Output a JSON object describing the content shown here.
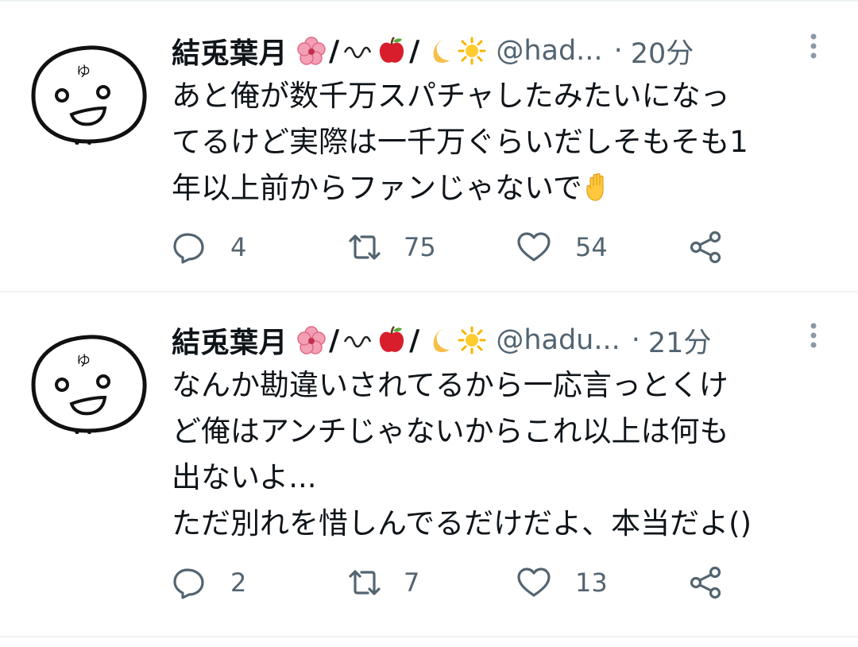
{
  "tweets": [
    {
      "display_name": "結兎葉月",
      "slash": "/",
      "handle": "@had...",
      "separator": "·",
      "time": "20分",
      "text": "あと俺が数千万スパチャしたみたいになっ\nてるけど実際は一千万ぐらいだしそもそも1\n年以上前からファンじゃないで",
      "trailing_emoji": "raised-hand",
      "replies": "4",
      "retweets": "75",
      "likes": "54"
    },
    {
      "display_name": "結兎葉月",
      "slash": "/",
      "handle": "@hadu...",
      "separator": "·",
      "time": "21分",
      "text": "なんか勘違いされてるから一応言っとくけ\nど俺はアンチじゃないからこれ以上は何も\n出ないよ...\nただ別れを惜しんでるだけだよ、本当だよ()",
      "replies": "2",
      "retweets": "7",
      "likes": "13"
    }
  ],
  "icons": {
    "name_emojis": [
      "hibiscus",
      "wave-dash",
      "apple",
      "crescent-moon",
      "sun"
    ],
    "actions": [
      "reply-icon",
      "retweet-icon",
      "like-icon",
      "share-icon",
      "more-icon"
    ]
  },
  "colors": {
    "text": "#0f1419",
    "secondary": "#536471",
    "divider": "#eff3f4",
    "hibiscus": "#f4a0b4",
    "apple": "#d81e2c",
    "moon": "#f5c04a",
    "sun": "#f7b500"
  }
}
